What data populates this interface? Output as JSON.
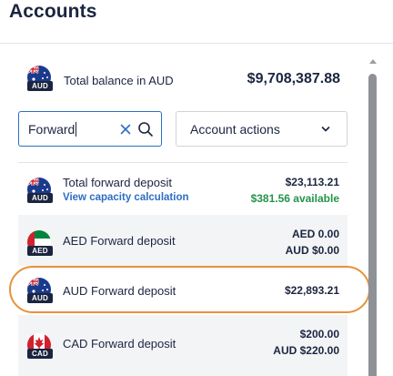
{
  "header": {
    "title": "Accounts"
  },
  "balance": {
    "label": "Total balance in AUD",
    "value": "$9,708,387.88",
    "flag_icon": "australia-flag-icon",
    "currency_code": "AUD"
  },
  "search": {
    "value": "Forward",
    "clear_icon": "close-icon",
    "search_icon": "search-icon"
  },
  "actions": {
    "label": "Account actions",
    "icon": "chevron-down-icon"
  },
  "accounts": [
    {
      "name": "Total forward deposit",
      "link": "View capacity calculation",
      "amount": "$23,113.21",
      "available": "$381.56 available",
      "currency_code": "AUD",
      "flag_icon": "australia-flag-icon"
    },
    {
      "name": "AED Forward deposit",
      "amount": "AED 0.00",
      "amount_aud": "AUD $0.00",
      "currency_code": "AED",
      "flag_icon": "uae-flag-icon"
    },
    {
      "name": "AUD Forward deposit",
      "amount": "$22,893.21",
      "currency_code": "AUD",
      "flag_icon": "australia-flag-icon",
      "highlighted": true
    },
    {
      "name": "CAD Forward deposit",
      "amount": "$200.00",
      "amount_aud": "AUD $220.00",
      "currency_code": "CAD",
      "flag_icon": "canada-flag-icon"
    }
  ],
  "colors": {
    "text": "#1b2540",
    "link": "#2d6ec2",
    "available": "#25934b",
    "highlight": "#e8913a",
    "row_shade": "#f3f4f6"
  }
}
